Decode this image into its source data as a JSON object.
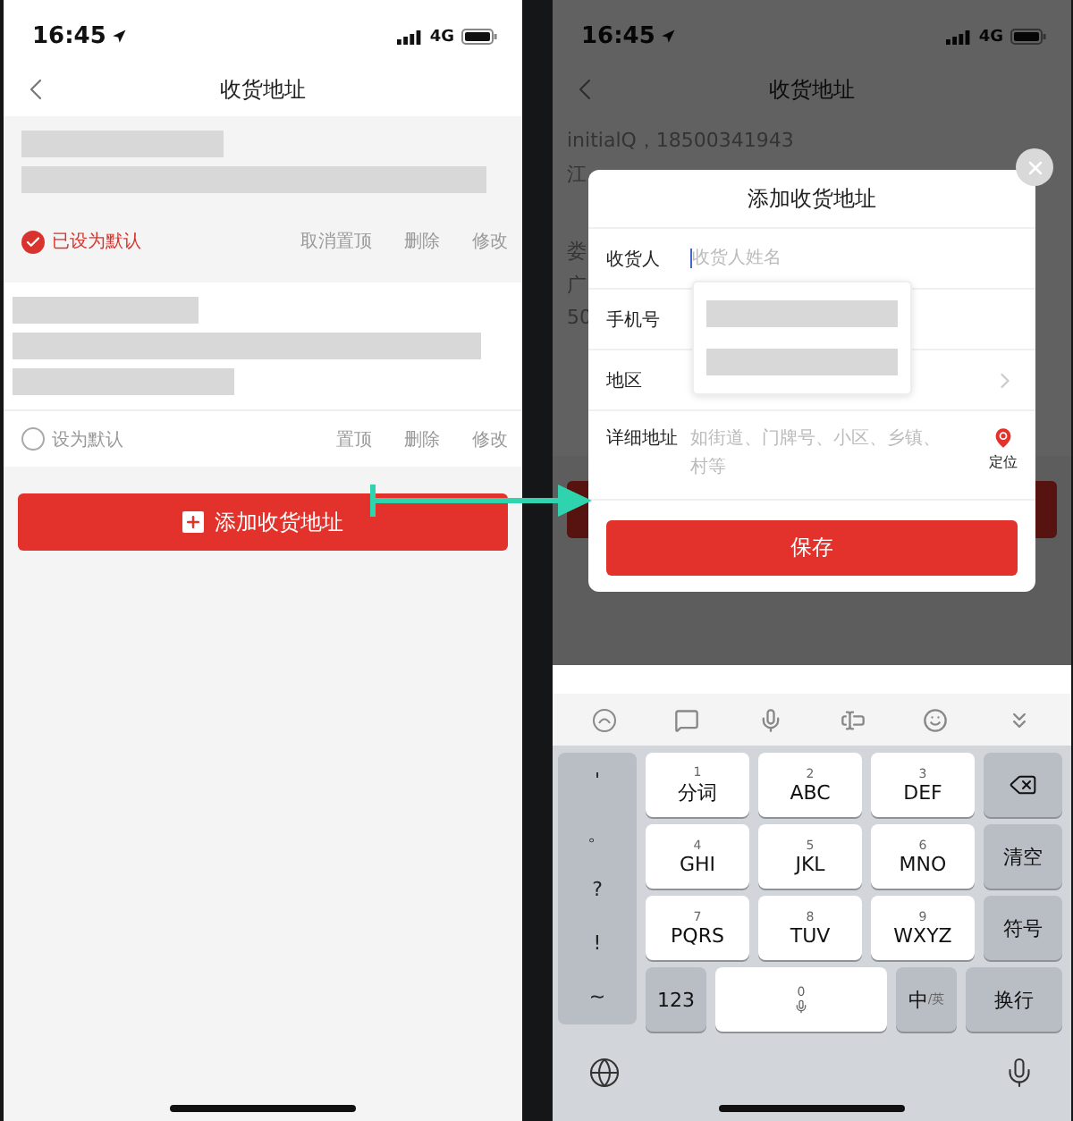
{
  "left_screen": {
    "status_bar": {
      "time": "16:45",
      "network": "4G"
    },
    "nav": {
      "title": "收货地址"
    },
    "addresses": [
      {
        "selected": true,
        "default_label": "已设为默认",
        "actions": [
          "取消置顶",
          "删除",
          "修改"
        ]
      },
      {
        "selected": false,
        "default_label": "设为默认",
        "actions": [
          "置顶",
          "删除",
          "修改"
        ]
      }
    ],
    "add_button": "添加收货地址"
  },
  "right_screen": {
    "status_bar": {
      "time": "16:45",
      "network": "4G"
    },
    "nav": {
      "title": "收货地址"
    },
    "background_lines": [
      "initialQ，18500341943",
      "江",
      "娄",
      "广",
      "50"
    ],
    "dialog": {
      "title": "添加收货地址",
      "fields": [
        {
          "kind": "text",
          "label": "收货人",
          "placeholder": "收货人姓名"
        },
        {
          "kind": "text",
          "label": "手机号"
        },
        {
          "kind": "select",
          "label": "地区"
        },
        {
          "kind": "area",
          "label": "详细地址",
          "placeholder": "如街道、门牌号、小区、乡镇、村等",
          "locate": "定位"
        }
      ],
      "save": "保存"
    },
    "keyboard": {
      "side_keys": [
        "'",
        "。",
        "?",
        "!",
        "~"
      ],
      "keys": [
        {
          "digit": "1",
          "letters": "分词"
        },
        {
          "digit": "2",
          "letters": "ABC"
        },
        {
          "digit": "3",
          "letters": "DEF"
        },
        {
          "digit": "4",
          "letters": "GHI"
        },
        {
          "digit": "5",
          "letters": "JKL"
        },
        {
          "digit": "6",
          "letters": "MNO"
        },
        {
          "digit": "7",
          "letters": "PQRS"
        },
        {
          "digit": "8",
          "letters": "TUV"
        },
        {
          "digit": "9",
          "letters": "WXYZ"
        }
      ],
      "right_keys": [
        "清空",
        "符号"
      ],
      "numbers_key": "123",
      "space_digit": "0",
      "lang_main": "中",
      "lang_alt": "/英",
      "enter_key": "换行"
    }
  }
}
